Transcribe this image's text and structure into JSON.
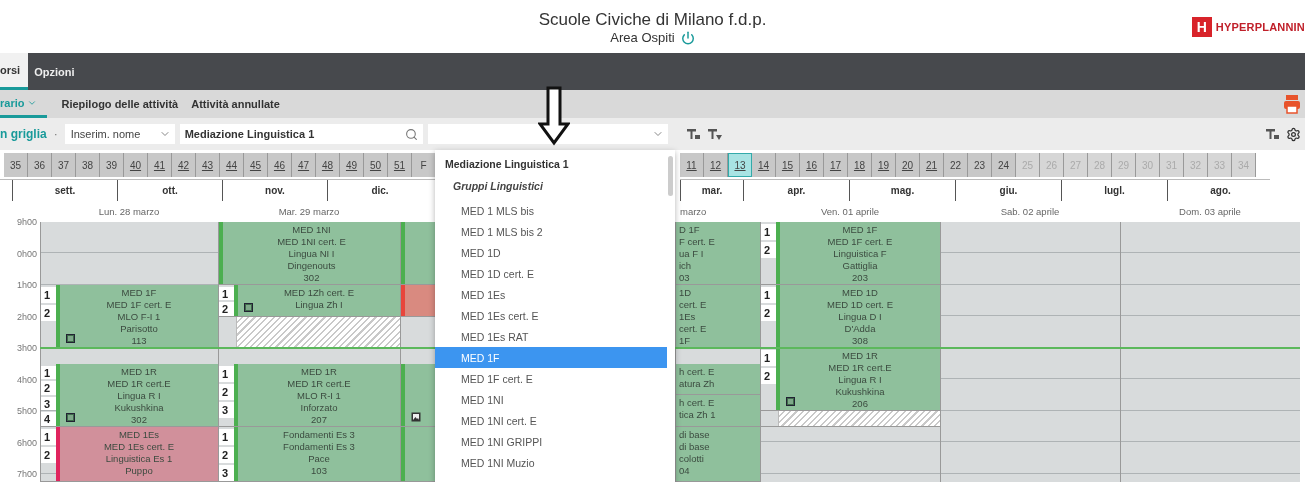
{
  "header": {
    "title": "Scuole Civiche di Milano f.d.p.",
    "subtitle": "Area Ospiti",
    "logo_mark": "H",
    "logo_text": "HYPERPLANNIN"
  },
  "nav_tabs": [
    {
      "label": "orsi",
      "selected": true
    },
    {
      "label": "Opzioni",
      "selected": false
    }
  ],
  "sub_tabs": [
    {
      "label": "rario",
      "selected": true,
      "dropdown": true
    },
    {
      "label": "Riepilogo delle attività",
      "selected": false,
      "dropdown": false
    },
    {
      "label": "Attività annullate",
      "selected": false,
      "dropdown": false
    }
  ],
  "toolbar": {
    "view_label": "n griglia",
    "separator": "·",
    "mode_select": "Inserim. nome",
    "search_value": "Mediazione Linguistica 1"
  },
  "weeks_left": [
    {
      "label": "35",
      "link": false,
      "disabled": false,
      "selected": false
    },
    {
      "label": "36",
      "link": false,
      "disabled": false,
      "selected": false
    },
    {
      "label": "37",
      "link": false,
      "disabled": false,
      "selected": false
    },
    {
      "label": "38",
      "link": false,
      "disabled": false,
      "selected": false
    },
    {
      "label": "39",
      "link": false,
      "disabled": false,
      "selected": false
    },
    {
      "label": "40",
      "link": true,
      "disabled": false,
      "selected": false
    },
    {
      "label": "41",
      "link": true,
      "disabled": false,
      "selected": false
    },
    {
      "label": "42",
      "link": true,
      "disabled": false,
      "selected": false
    },
    {
      "label": "43",
      "link": true,
      "disabled": false,
      "selected": false
    },
    {
      "label": "44",
      "link": true,
      "disabled": false,
      "selected": false
    },
    {
      "label": "45",
      "link": true,
      "disabled": false,
      "selected": false
    },
    {
      "label": "46",
      "link": true,
      "disabled": false,
      "selected": false
    },
    {
      "label": "47",
      "link": true,
      "disabled": false,
      "selected": false
    },
    {
      "label": "48",
      "link": true,
      "disabled": false,
      "selected": false
    },
    {
      "label": "49",
      "link": true,
      "disabled": false,
      "selected": false
    },
    {
      "label": "50",
      "link": true,
      "disabled": false,
      "selected": false
    },
    {
      "label": "51",
      "link": true,
      "disabled": false,
      "selected": false
    },
    {
      "label": "F",
      "link": false,
      "disabled": false,
      "selected": false
    }
  ],
  "weeks_right": [
    {
      "label": "11",
      "link": true,
      "disabled": false,
      "selected": false
    },
    {
      "label": "12",
      "link": true,
      "disabled": false,
      "selected": false
    },
    {
      "label": "13",
      "link": true,
      "disabled": false,
      "selected": true
    },
    {
      "label": "14",
      "link": true,
      "disabled": false,
      "selected": false
    },
    {
      "label": "15",
      "link": true,
      "disabled": false,
      "selected": false
    },
    {
      "label": "16",
      "link": true,
      "disabled": false,
      "selected": false
    },
    {
      "label": "17",
      "link": true,
      "disabled": false,
      "selected": false
    },
    {
      "label": "18",
      "link": true,
      "disabled": false,
      "selected": false
    },
    {
      "label": "19",
      "link": true,
      "disabled": false,
      "selected": false
    },
    {
      "label": "20",
      "link": true,
      "disabled": false,
      "selected": false
    },
    {
      "label": "21",
      "link": true,
      "disabled": false,
      "selected": false
    },
    {
      "label": "22",
      "link": false,
      "disabled": false,
      "selected": false
    },
    {
      "label": "23",
      "link": false,
      "disabled": false,
      "selected": false
    },
    {
      "label": "24",
      "link": false,
      "disabled": false,
      "selected": false
    },
    {
      "label": "25",
      "link": false,
      "disabled": true,
      "selected": false
    },
    {
      "label": "26",
      "link": false,
      "disabled": true,
      "selected": false
    },
    {
      "label": "27",
      "link": false,
      "disabled": true,
      "selected": false
    },
    {
      "label": "28",
      "link": false,
      "disabled": true,
      "selected": false
    },
    {
      "label": "29",
      "link": false,
      "disabled": true,
      "selected": false
    },
    {
      "label": "30",
      "link": false,
      "disabled": true,
      "selected": false
    },
    {
      "label": "31",
      "link": false,
      "disabled": true,
      "selected": false
    },
    {
      "label": "32",
      "link": false,
      "disabled": true,
      "selected": false
    },
    {
      "label": "33",
      "link": false,
      "disabled": true,
      "selected": false
    },
    {
      "label": "34",
      "link": false,
      "disabled": true,
      "selected": false
    }
  ],
  "months_left": [
    "sett.",
    "ott.",
    "nov.",
    "dic."
  ],
  "months_right": [
    "mar.",
    "apr.",
    "mag.",
    "giu.",
    "lugl.",
    "ago."
  ],
  "hours": [
    "9h00",
    "0h00",
    "1h00",
    "2h00",
    "3h00",
    "4h00",
    "5h00",
    "6h00",
    "7h00"
  ],
  "days": [
    {
      "label": "Lun. 28 marzo",
      "partial": false,
      "events": [
        {
          "kind": "note",
          "parts": [
            "1",
            "2"
          ],
          "lines": [
            "MED 1F",
            "MED 1F cert. E",
            "MLO F-I 1",
            "Parisotto",
            "113"
          ]
        },
        {
          "kind": "note",
          "parts": [
            "1",
            "2",
            "3",
            "4"
          ],
          "lines": [
            "MED 1R",
            "MED 1R cert.E",
            "Lingua R I",
            "Kukushkina",
            "302"
          ]
        },
        {
          "kind": "changed",
          "parts": [
            "1",
            "2"
          ],
          "lines": [
            "MED 1Es",
            "MED 1Es cert. E",
            "Linguistica Es 1",
            "Puppo"
          ]
        }
      ]
    },
    {
      "label": "Mar. 29 marzo",
      "partial": false,
      "events": [
        {
          "kind": "lesson",
          "lines": [
            "MED 1NI",
            "MED 1NI cert. E",
            "Lingua NI I",
            "Dingenouts",
            "302"
          ]
        },
        {
          "kind": "note",
          "parts": [
            "1",
            "2"
          ],
          "lines": [
            "MED 1Zh cert. E",
            "Lingua Zh I"
          ]
        },
        {
          "kind": "blocked"
        },
        {
          "kind": "lesson",
          "parts": [
            "1",
            "2",
            "3"
          ],
          "lines": [
            "MED 1R",
            "MED 1R cert.E",
            "MLO R-I 1",
            "Inforzato",
            "207"
          ]
        },
        {
          "kind": "lesson",
          "parts": [
            "1",
            "2",
            "3"
          ],
          "lines": [
            "Fondamenti Es 3",
            "Fondamenti Es 3",
            "Pace",
            "103"
          ]
        }
      ]
    },
    {
      "events": [
        {
          "kind": "lesson"
        },
        {
          "kind": "moved"
        },
        {
          "kind": "image"
        },
        {
          "kind": "lesson"
        }
      ]
    },
    {
      "label": "marzo",
      "partial": true,
      "events": [
        {
          "kind": "lesson",
          "lines": [
            "D 1F",
            "F cert. E",
            "ua F I",
            "ich",
            "03"
          ]
        },
        {
          "kind": "lesson",
          "lines": [
            "1D",
            "cert. E",
            "1Es",
            "cert. E",
            "1F"
          ]
        },
        {
          "kind": "lesson",
          "lines": [
            "h cert. E",
            "atura Zh"
          ]
        },
        {
          "kind": "lesson",
          "lines": [
            "h cert. E",
            "tica Zh 1"
          ]
        },
        {
          "kind": "lesson",
          "lines": [
            "di base",
            "di base",
            "colotti",
            "04"
          ]
        }
      ]
    },
    {
      "label": "Ven. 01 aprile",
      "partial": false,
      "events": [
        {
          "kind": "lesson",
          "parts": [
            "1",
            "2"
          ],
          "lines": [
            "MED 1F",
            "MED 1F cert. E",
            "Linguistica F",
            "Gattiglia",
            "203"
          ]
        },
        {
          "kind": "lesson",
          "parts": [
            "1",
            "2"
          ],
          "lines": [
            "MED 1D",
            "MED 1D cert. E",
            "Lingua D I",
            "D'Adda",
            "308"
          ]
        },
        {
          "kind": "note",
          "parts": [
            "1",
            "2"
          ],
          "lines": [
            "MED 1R",
            "MED 1R cert.E",
            "Lingua R I",
            "Kukushkina",
            "206"
          ]
        },
        {
          "kind": "blocked"
        }
      ]
    },
    {
      "label": "Sab. 02 aprile",
      "partial": false
    },
    {
      "label": "Dom. 03 aprile",
      "partial": false
    }
  ],
  "dropdown": {
    "title": "Mediazione Linguistica 1",
    "group": "Gruppi Linguistici",
    "items": [
      {
        "label": "MED 1 MLS bis",
        "selected": false
      },
      {
        "label": "MED 1 MLS bis 2",
        "selected": false
      },
      {
        "label": "MED 1D",
        "selected": false
      },
      {
        "label": "MED 1D cert. E",
        "selected": false
      },
      {
        "label": "MED 1Es",
        "selected": false
      },
      {
        "label": "MED 1Es cert. E",
        "selected": false
      },
      {
        "label": "MED 1Es RAT",
        "selected": false
      },
      {
        "label": "MED 1F",
        "selected": true
      },
      {
        "label": "MED 1F cert. E",
        "selected": false
      },
      {
        "label": "MED 1NI",
        "selected": false
      },
      {
        "label": "MED 1NI cert. E",
        "selected": false
      },
      {
        "label": "MED 1NI GRIPPI",
        "selected": false
      },
      {
        "label": "MED 1NI Muzio",
        "selected": false
      }
    ]
  }
}
